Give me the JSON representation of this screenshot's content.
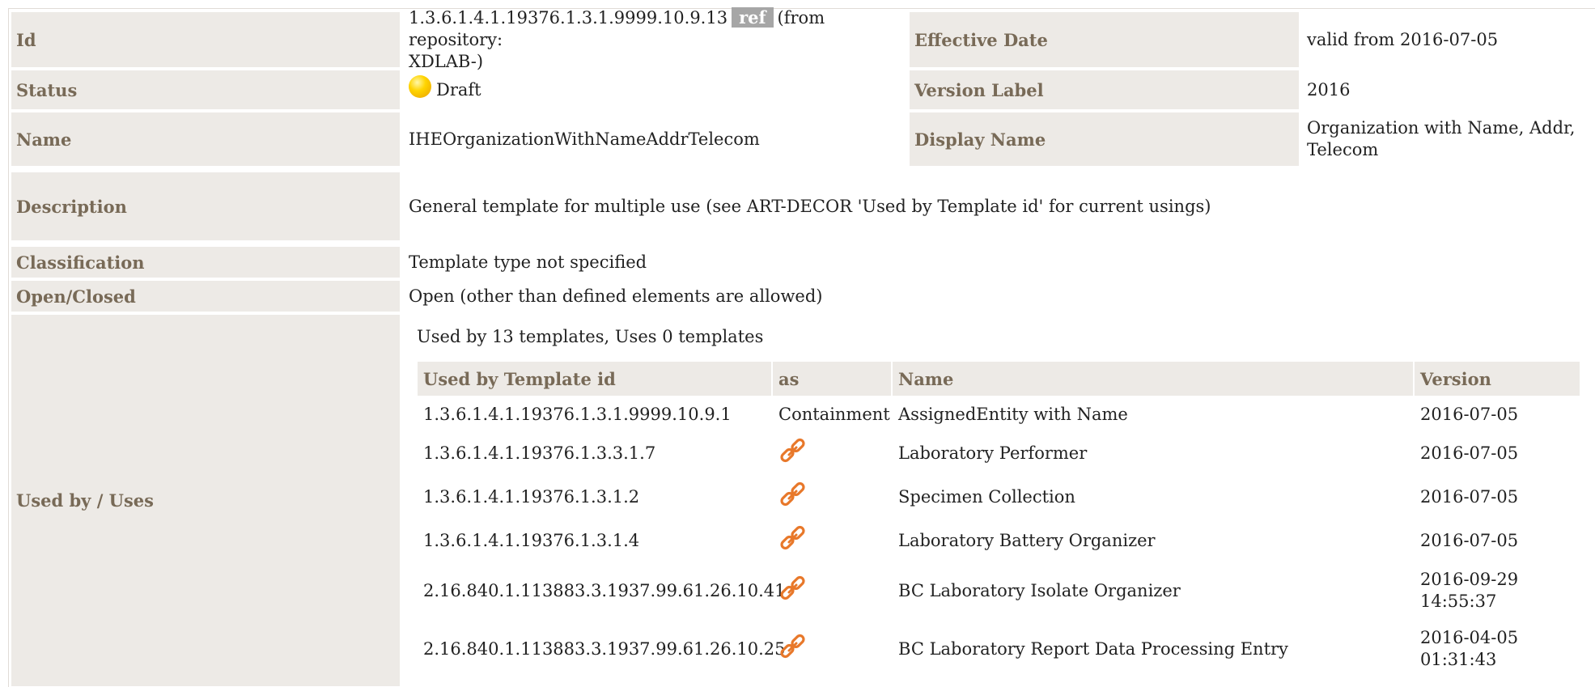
{
  "rows": {
    "id": {
      "label": "Id",
      "value_oid": "1.3.6.1.4.1.19376.1.3.1.9999.10.9.13",
      "ref_badge": "ref",
      "value_suffix": "(from repository:",
      "value_line2": "XDLAB-)"
    },
    "effective_date": {
      "label": "Effective Date",
      "value": "valid from 2016-07-05"
    },
    "status": {
      "label": "Status",
      "value": "Draft",
      "icon": "status-draft-icon",
      "icon_color": "#ffd400"
    },
    "version_label": {
      "label": "Version Label",
      "value": "2016"
    },
    "name": {
      "label": "Name",
      "value": "IHEOrganizationWithNameAddrTelecom"
    },
    "display_name": {
      "label": "Display Name",
      "value_line1": "Organization with Name, Addr,",
      "value_line2": "Telecom"
    },
    "description": {
      "label": "Description",
      "value": "General template for multiple use (see ART-DECOR 'Used by Template id' for current usings)"
    },
    "classification": {
      "label": "Classification",
      "value": "Template type not specified"
    },
    "open_closed": {
      "label": "Open/Closed",
      "value": "Open (other than defined elements are allowed)"
    },
    "used_by": {
      "label": "Used by / Uses"
    }
  },
  "usage": {
    "caption": "Used by 13 templates, Uses 0 templates",
    "headers": {
      "template_id": "Used by Template id",
      "as": "as",
      "name": "Name",
      "version": "Version"
    },
    "rows": [
      {
        "template_id": "1.3.6.1.4.1.19376.1.3.1.9999.10.9.1",
        "as": "Containment",
        "name": "AssignedEntity with Name",
        "version": "2016-07-05",
        "version_line2": ""
      },
      {
        "template_id": "1.3.6.1.4.1.19376.1.3.3.1.7",
        "as": "",
        "as_icon": "link-icon",
        "name": "Laboratory Performer",
        "version": "2016-07-05",
        "version_line2": ""
      },
      {
        "template_id": "1.3.6.1.4.1.19376.1.3.1.2",
        "as": "",
        "as_icon": "link-icon",
        "name": "Specimen Collection",
        "version": "2016-07-05",
        "version_line2": ""
      },
      {
        "template_id": "1.3.6.1.4.1.19376.1.3.1.4",
        "as": "",
        "as_icon": "link-icon",
        "name": "Laboratory Battery Organizer",
        "version": "2016-07-05",
        "version_line2": ""
      },
      {
        "template_id": "2.16.840.1.113883.3.1937.99.61.26.10.41",
        "as": "",
        "as_icon": "link-icon",
        "name": "BC Laboratory Isolate Organizer",
        "version": "2016-09-29",
        "version_line2": "14:55:37"
      },
      {
        "template_id": "2.16.840.1.113883.3.1937.99.61.26.10.25",
        "as": "",
        "as_icon": "link-icon",
        "name": "BC Laboratory Report Data Processing Entry",
        "version": "2016-04-05",
        "version_line2": "01:31:43"
      }
    ],
    "link_icon_color": "#e8782a"
  }
}
